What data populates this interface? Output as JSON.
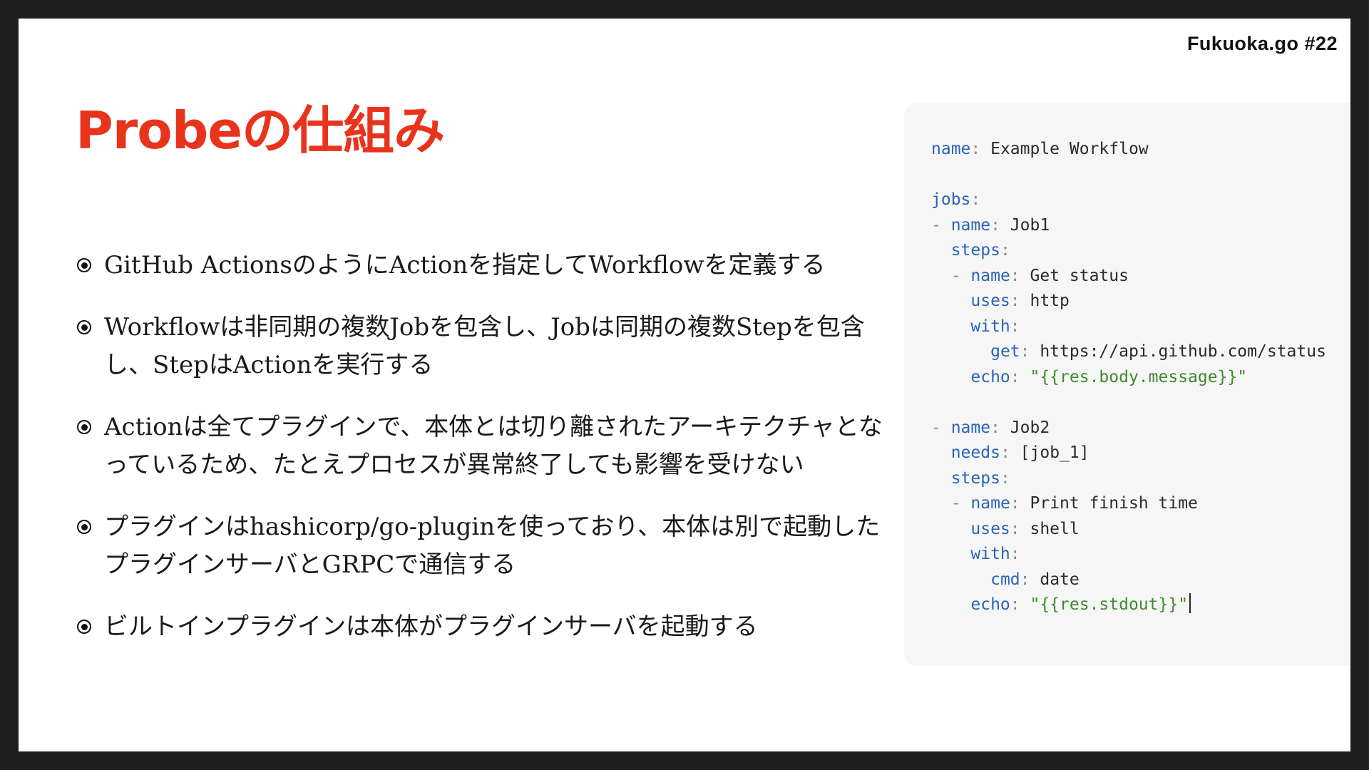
{
  "slide": {
    "event_tag": "Fukuoka.go #22",
    "title": "Probeの仕組み",
    "bullets": [
      "GitHub ActionsのようにActionを指定してWorkflowを定義する",
      "Workflowは非同期の複数Jobを包含し、Jobは同期の複数Stepを包含し、StepはActionを実行する",
      "Actionは全てプラグインで、本体とは切り離されたアーキテクチャとなっているため、たとえプロセスが異常終了しても影響を受けない",
      "プラグインはhashicorp/go-pluginを使っており、本体は別で起動したプラグインサーバとGRPCで通信する",
      "ビルトインプラグインは本体がプラグインサーバを起動する"
    ]
  },
  "code": {
    "l1": {
      "key": "name",
      "colon": ":",
      "value": " Example Workflow"
    },
    "l3": {
      "key": "jobs",
      "colon": ":"
    },
    "l4": {
      "dash": "- ",
      "key": "name",
      "colon": ":",
      "value": " Job1"
    },
    "l5": {
      "key": "steps",
      "colon": ":"
    },
    "l6": {
      "dash": "- ",
      "key": "name",
      "colon": ":",
      "value": " Get status"
    },
    "l7": {
      "key": "uses",
      "colon": ":",
      "value": " http"
    },
    "l8": {
      "key": "with",
      "colon": ":"
    },
    "l9": {
      "key": "get",
      "colon": ":",
      "value": " https://api.github.com/status"
    },
    "l10": {
      "key": "echo",
      "colon": ":",
      "value": " \"{{res.body.message}}\""
    },
    "l12": {
      "dash": "- ",
      "key": "name",
      "colon": ":",
      "value": " Job2"
    },
    "l13": {
      "key": "needs",
      "colon": ":",
      "value": " [job_1]"
    },
    "l14": {
      "key": "steps",
      "colon": ":"
    },
    "l15": {
      "dash": "- ",
      "key": "name",
      "colon": ":",
      "value": " Print finish time"
    },
    "l16": {
      "key": "uses",
      "colon": ":",
      "value": " shell"
    },
    "l17": {
      "key": "with",
      "colon": ":"
    },
    "l18": {
      "key": "cmd",
      "colon": ":",
      "value": " date"
    },
    "l19": {
      "key": "echo",
      "colon": ":",
      "value": " \"{{res.stdout}}\""
    }
  }
}
